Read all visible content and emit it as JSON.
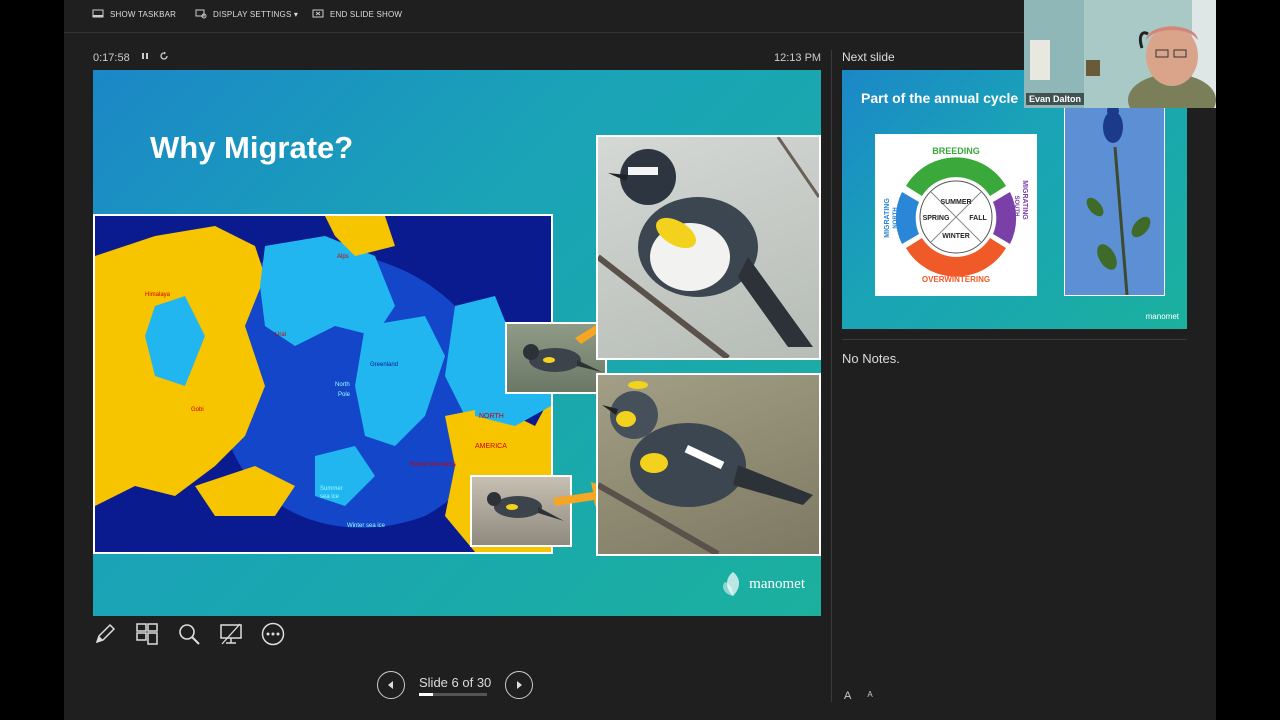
{
  "topbar": {
    "show_taskbar": "SHOW TASKBAR",
    "display_settings": "DISPLAY SETTINGS ▾",
    "end_slide_show": "END SLIDE SHOW"
  },
  "timer": {
    "elapsed": "0:17:58",
    "clock": "12:13 PM"
  },
  "current_slide": {
    "title": "Why Migrate?",
    "map_labels": {
      "alps": "Alps",
      "himalaya": "Himalaya",
      "ural": "Ural",
      "gobi": "Gobi",
      "greenland": "Greenland",
      "north_pole_1": "North",
      "north_pole_2": "Pole",
      "north": "NORTH",
      "america": "AMERICA",
      "rocky": "Rocky Mountains",
      "summer_ice_1": "Summer",
      "summer_ice_2": "sea ice",
      "winter_ice": "Winter sea ice"
    },
    "logo": "manomet"
  },
  "toolbar": {
    "icons": [
      "pen-icon",
      "see-all-slides-icon",
      "zoom-icon",
      "black-screen-icon",
      "more-options-icon"
    ]
  },
  "navigation": {
    "counter": "Slide 6 of 30",
    "current": 6,
    "total": 30,
    "progress_fraction": 0.2
  },
  "next_slide": {
    "label": "Next slide",
    "title": "Part of the annual cycle",
    "cycle": {
      "breeding": "BREEDING",
      "migrating_south": "MIGRATING",
      "south": "SOUTH",
      "migrating_north": "MIGRATING",
      "north": "NORTH",
      "overwintering": "OVERWINTERING",
      "summer": "SUMMER",
      "spring": "SPRING",
      "fall": "FALL",
      "winter": "WINTER"
    },
    "logo": "manomet"
  },
  "notes": {
    "text": "No Notes."
  },
  "font_controls": {
    "increase": "A",
    "decrease": "A"
  },
  "webcam": {
    "name": "Evan Dalton"
  },
  "colors": {
    "slide_gradient_start": "#1b87c7",
    "slide_gradient_end": "#1bb09e",
    "map_ocean": "#0a1a8f",
    "map_land": "#f7c400",
    "map_ice": "#22b6f0",
    "breeding_green": "#3aa83a",
    "migrating_purple": "#7b3fa8",
    "overwintering_orange": "#f05a28",
    "migrating_blue": "#2a86d6"
  }
}
